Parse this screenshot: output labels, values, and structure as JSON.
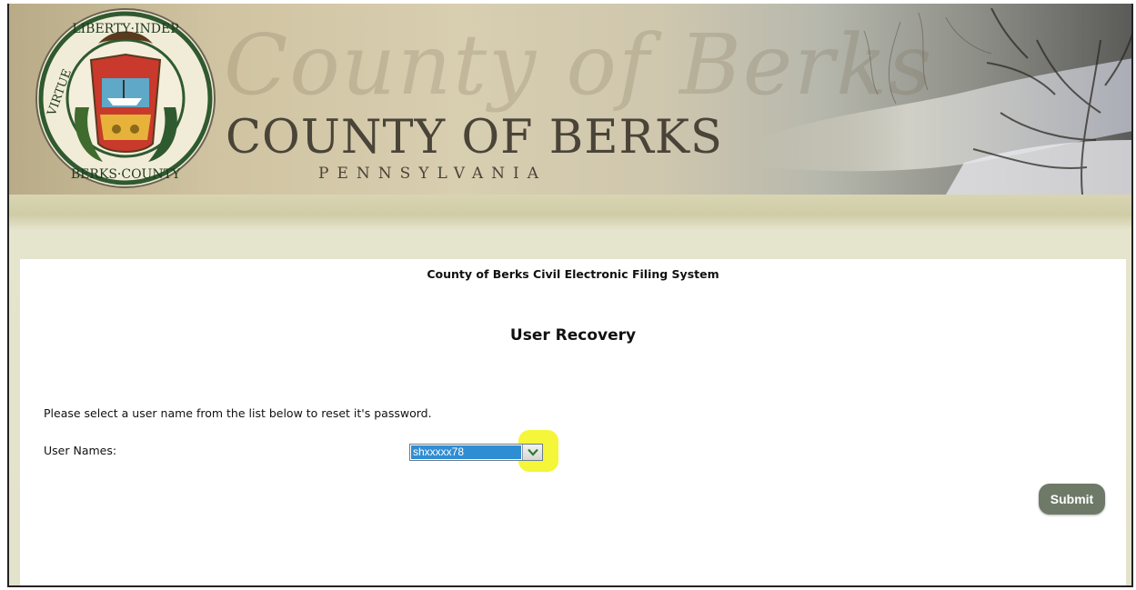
{
  "header": {
    "script_title": "County of Berks",
    "title": "COUNTY OF BERKS",
    "subtitle": "PENNSYLVANIA",
    "seal_text": "LIBERTY INDEPENDENCE VIRTUE BERKS COUNTY"
  },
  "main": {
    "system_title": "County of Berks Civil Electronic Filing System",
    "page_title": "User Recovery",
    "instruction": "Please select a user name from the list below to reset it's password.",
    "user_names_label": "User Names:",
    "user_names_selected": "shxxxxx78",
    "submit_label": "Submit"
  },
  "icons": {
    "dropdown": "chevron-down-icon",
    "seal": "county-seal-icon"
  },
  "colors": {
    "highlight": "#f5f53a",
    "select_value_bg": "#2f8dd3",
    "submit_bg": "#6e7a67",
    "dropdown_arrow": "#2e7d2e"
  }
}
